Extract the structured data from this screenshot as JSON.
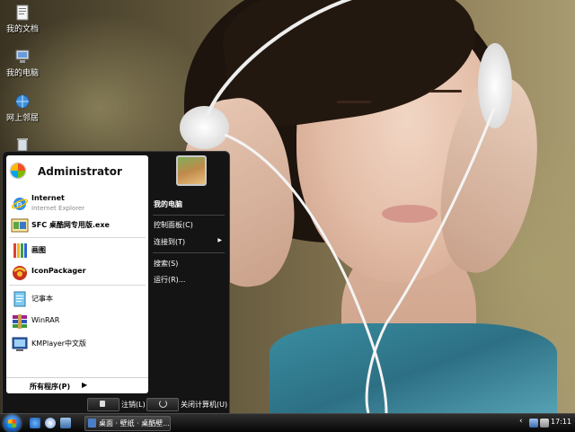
{
  "desktop": {
    "icons": [
      {
        "label": "我的文档",
        "icon": "my-documents-icon"
      },
      {
        "label": "我的电脑",
        "icon": "my-computer-icon"
      },
      {
        "label": "网上邻居",
        "icon": "network-places-icon"
      },
      {
        "label": "",
        "icon": "recycle-bin-icon"
      }
    ]
  },
  "start_menu": {
    "user_name": "Administrator",
    "pinned": [
      {
        "title": "Internet",
        "subtitle": "Internet Explorer",
        "icon": "internet-explorer-icon"
      },
      {
        "title": "SFC 桌酷网专用版.exe",
        "icon": "sfc-exe-icon"
      }
    ],
    "recent": [
      {
        "title": "画图",
        "icon": "paint-icon"
      },
      {
        "title": "IconPackager",
        "icon": "iconpackager-icon"
      },
      {
        "title": "记事本",
        "icon": "notepad-icon"
      },
      {
        "title": "WinRAR",
        "icon": "winrar-icon"
      },
      {
        "title": "KMPlayer中文版",
        "icon": "kmplayer-icon"
      }
    ],
    "all_programs": "所有程序(P)",
    "right_items": [
      {
        "label": "我的电脑",
        "bold": true
      },
      {
        "label": "控制面板(C)"
      },
      {
        "label": "连接到(T)",
        "has_arrow": true
      },
      {
        "label": "搜索(S)"
      },
      {
        "label": "运行(R)..."
      }
    ],
    "logoff_label": "注销(L)",
    "shutdown_label": "关闭计算机(U)"
  },
  "taskbar": {
    "task_button_label": "桌面 · 壁纸 · 桌酷壁...",
    "tray_chevron": "‹",
    "clock": "17:11",
    "quick_launch": [
      "ie-icon",
      "media-icon",
      "show-desktop-icon"
    ]
  },
  "colors": {
    "menu_dark": "#141414",
    "menu_light": "#ffffff",
    "taskbar": "#0a0a0a"
  }
}
